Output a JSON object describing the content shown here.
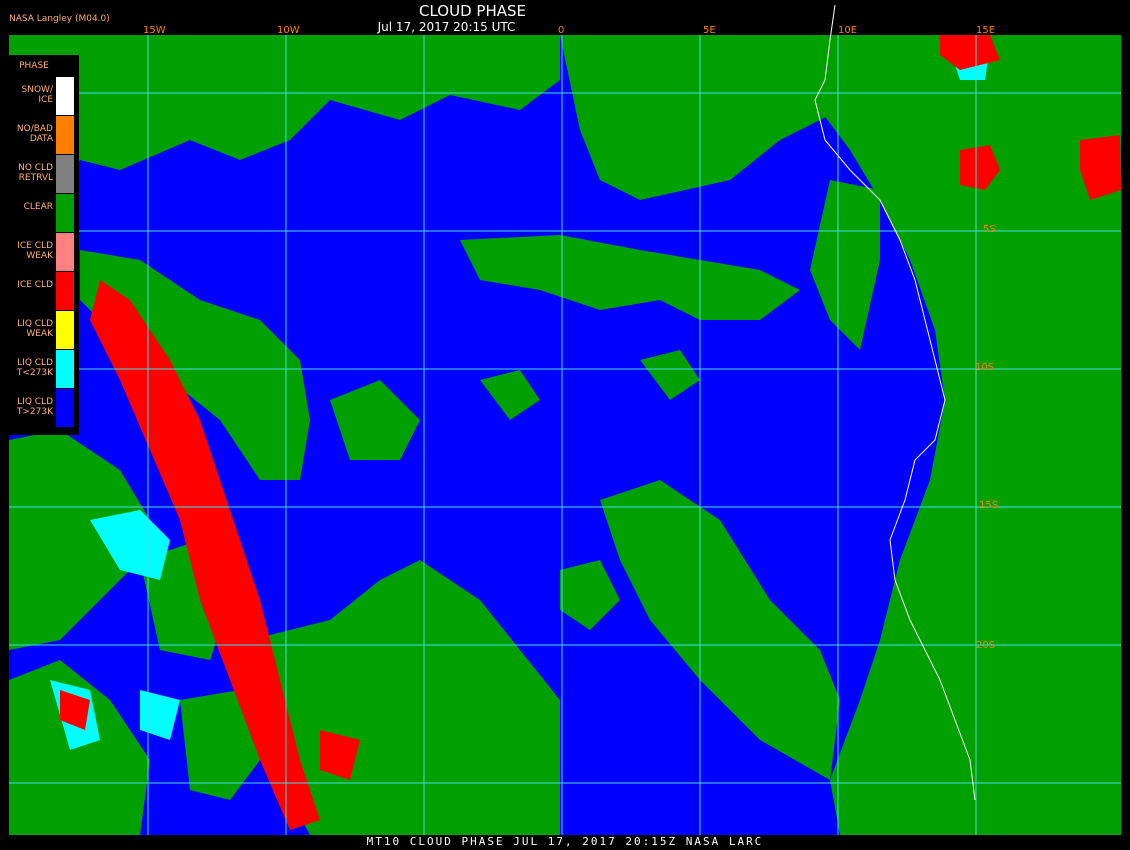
{
  "header": {
    "title": "CLOUD PHASE",
    "subtitle": "Jul 17, 2017 20:15 UTC",
    "credit": "NASA Langley (M04.0)"
  },
  "footer": {
    "caption": "MT10  CLOUD PHASE  JUL 17, 2017 20:15Z  NASA LARC"
  },
  "legend": {
    "title": "PHASE",
    "items": [
      {
        "label": "SNOW/ ICE",
        "color": "#ffffff"
      },
      {
        "label": "NO/BAD DATA",
        "color": "#ff8000"
      },
      {
        "label": "NO CLD RETRVL",
        "color": "#808080"
      },
      {
        "label": "CLEAR",
        "color": "#00a000"
      },
      {
        "label": "ICE CLD WEAK",
        "color": "#ff8080"
      },
      {
        "label": "ICE CLD",
        "color": "#ff0000"
      },
      {
        "label": "LIQ CLD WEAK",
        "color": "#ffff00"
      },
      {
        "label": "LIQ CLD T<273K",
        "color": "#00ffff"
      },
      {
        "label": "LIQ CLD T>273K",
        "color": "#0000ff"
      }
    ]
  },
  "grid": {
    "longitude_labels": [
      "15W",
      "10W",
      "0",
      "5E",
      "10E",
      "15E"
    ],
    "latitude_labels": [
      "5S",
      "10S",
      "15S",
      "20S"
    ]
  },
  "colors": {
    "grid": "#40e0e0",
    "coast": "#ffffff",
    "label": "#ff8000"
  }
}
